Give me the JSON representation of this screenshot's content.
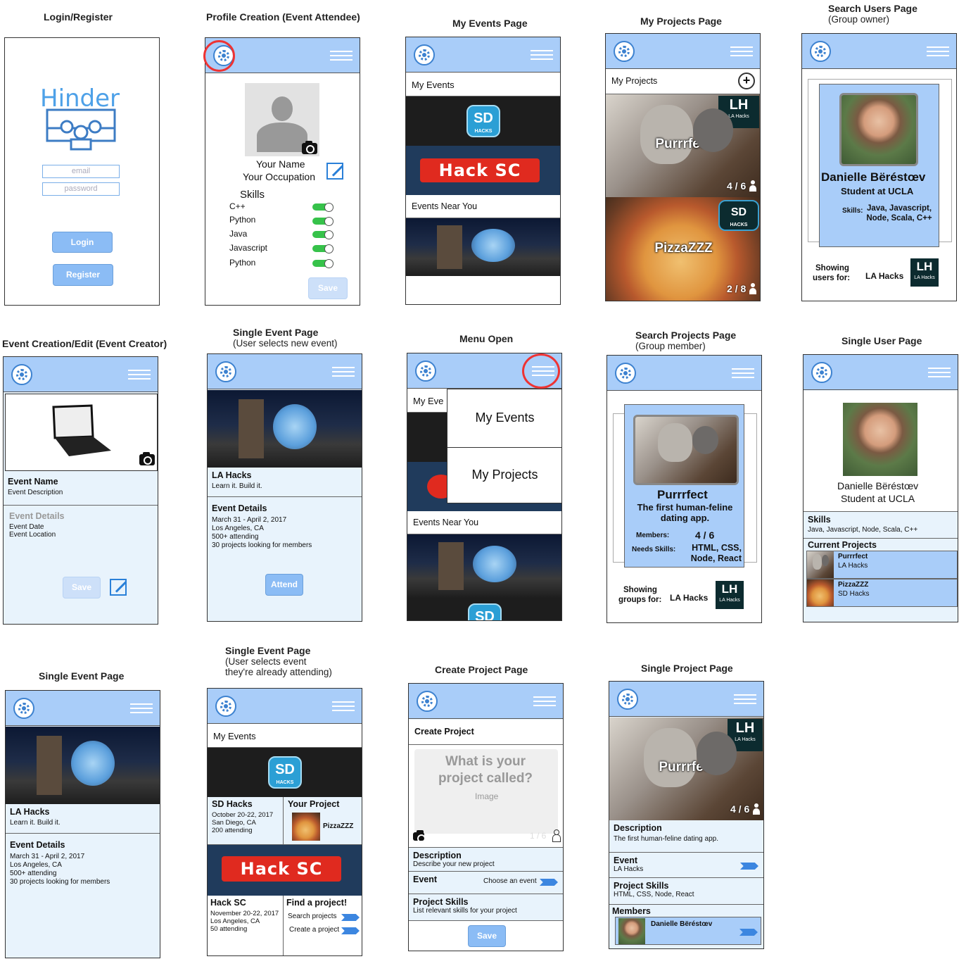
{
  "titles": {
    "login": "Login/Register",
    "profile": "Profile Creation (Event Attendee)",
    "my_events": "My Events Page",
    "my_projects": "My Projects Page",
    "search_users": "Search Users Page",
    "search_users_sub": "(Group owner)",
    "event_creation": "Event Creation/Edit (Event Creator)",
    "single_event_new": "Single Event Page",
    "single_event_new_sub": "(User selects new event)",
    "menu_open": "Menu Open",
    "search_projects": "Search Projects Page",
    "search_projects_sub": "(Group member)",
    "single_user": "Single User Page",
    "single_event": "Single Event Page",
    "single_event_att": "Single Event Page",
    "single_event_att_sub1": "(User selects event",
    "single_event_att_sub2": "they're already attending)",
    "create_project": "Create Project Page",
    "single_project": "Single Project Page"
  },
  "login": {
    "logo": "Hinder",
    "email_placeholder": "email",
    "password_placeholder": "password",
    "login_btn": "Login",
    "register_btn": "Register"
  },
  "profile": {
    "name": "Your Name",
    "occupation": "Your Occupation",
    "skills_label": "Skills",
    "skills": [
      "C++",
      "Python",
      "Java",
      "Javascript",
      "Python"
    ],
    "save": "Save"
  },
  "my_events": {
    "header": "My Events",
    "near": "Events Near You",
    "sd_logo": "SD",
    "sd_sub": "HACKS",
    "hacksc": "Hack SC"
  },
  "my_projects": {
    "header": "My Projects",
    "add": "+",
    "p1_title": "Purrrfect",
    "p1_count": "4 / 6",
    "p2_title": "PizzaZZZ",
    "p2_count": "2 / 8",
    "badge": "LA Hacks"
  },
  "search_users": {
    "name": "Danielle Bëréstœv",
    "role": "Student at UCLA",
    "skills_label": "Skills:",
    "skills": "Java, Javascript, Node, Scala, C++",
    "showing_1": "Showing",
    "showing_2": "users for:",
    "event": "LA Hacks",
    "badge": "LA Hacks"
  },
  "event_creation": {
    "name": "Event Name",
    "desc": "Event Description",
    "details": "Event Details",
    "date": "Event Date",
    "location": "Event Location",
    "save": "Save"
  },
  "single_event_new": {
    "name": "LA Hacks",
    "tag": "Learn it. Build it.",
    "details": "Event Details",
    "l1": "March 31 - April 2, 2017",
    "l2": "Los Angeles, CA",
    "l3": "500+ attending",
    "l4": "30 projects looking for members",
    "attend": "Attend"
  },
  "menu_open": {
    "my_eve": "My Eve",
    "menu1": "My Events",
    "menu2": "My Projects",
    "near": "Events Near You"
  },
  "search_projects": {
    "title": "Purrrfect",
    "desc": "The first human-feline dating app.",
    "members_label": "Members:",
    "members": "4 / 6",
    "needs_label": "Needs Skills:",
    "needs": "HTML, CSS, Node, React",
    "showing_1": "Showing",
    "showing_2": "groups for:",
    "event": "LA Hacks"
  },
  "single_user": {
    "name": "Danielle Bëréstœv",
    "role": "Student at UCLA",
    "skills_h": "Skills",
    "skills": "Java, Javascript, Node, Scala, C++",
    "current_h": "Current Projects",
    "p1": "Purrrfect",
    "p1e": "LA Hacks",
    "p2": "PizzaZZZ",
    "p2e": "SD Hacks"
  },
  "single_event": {
    "name": "LA Hacks",
    "tag": "Learn it. Build it.",
    "details": "Event Details",
    "l1": "March 31 - April 2, 2017",
    "l2": "Los Angeles, CA",
    "l3": "500+ attending",
    "l4": "30 projects looking for members"
  },
  "single_event_att": {
    "header": "My Events",
    "sd_name": "SD Hacks",
    "sd_l1": "October 20-22, 2017",
    "sd_l2": "San Diego, CA",
    "sd_l3": "200 attending",
    "your_project": "Your Project",
    "pizza": "PizzaZZZ",
    "hsc_name": "Hack SC",
    "hsc_l1": "November 20-22, 2017",
    "hsc_l2": "Los Angeles, CA",
    "hsc_l3": "50 attending",
    "find": "Find a project!",
    "search": "Search projects",
    "create": "Create a project"
  },
  "create_project": {
    "header": "Create Project",
    "prompt": "What is your project called?",
    "image": "Image",
    "count": "1 / 6",
    "desc_h": "Description",
    "desc": "Describe your new project",
    "event_h": "Event",
    "choose": "Choose an event",
    "skills_h": "Project Skills",
    "skills": "List relevant skills for your project",
    "save": "Save"
  },
  "single_project": {
    "title": "Purrrfect",
    "count": "4 / 6",
    "desc_h": "Description",
    "desc": "The first human-feline dating app.",
    "event_h": "Event",
    "event": "LA Hacks",
    "skills_h": "Project Skills",
    "skills": "HTML, CSS, Node, React",
    "members_h": "Members",
    "member": "Danielle Bëréstœv"
  }
}
